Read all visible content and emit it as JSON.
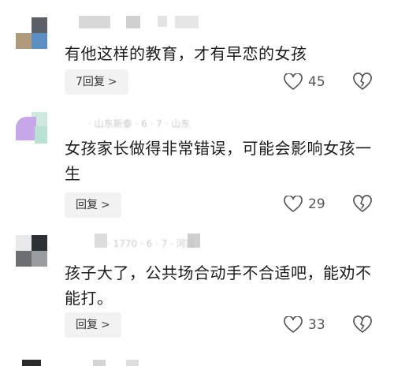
{
  "comments": [
    {
      "meta_text": "",
      "text": "有他这样的教育，才有早恋的女孩",
      "reply_label": "7回复",
      "like_count": "45",
      "icons": {
        "like": "heart-outline-icon",
        "dislike": "broken-heart-icon",
        "reply": "chevron-right-icon"
      }
    },
    {
      "meta_text": "· 山东新泰 · 6 · 7 · 山东",
      "text": "女孩家长做得非常错误，可能会影响女孩一生",
      "reply_label": "回复",
      "like_count": "29",
      "icons": {
        "like": "heart-outline-icon",
        "dislike": "broken-heart-icon",
        "reply": "chevron-right-icon"
      }
    },
    {
      "meta_text": "· 1770 · 6 · 7 · 河南",
      "text": "孩子大了，公共场合动手不合适吧，能劝不能打。",
      "reply_label": "回复",
      "like_count": "33",
      "icons": {
        "like": "heart-outline-icon",
        "dislike": "broken-heart-icon",
        "reply": "chevron-right-icon"
      }
    }
  ],
  "colors": {
    "reply_bg": "#f2f2f2",
    "icon_stroke": "#555555",
    "text": "#1c1c1c"
  }
}
